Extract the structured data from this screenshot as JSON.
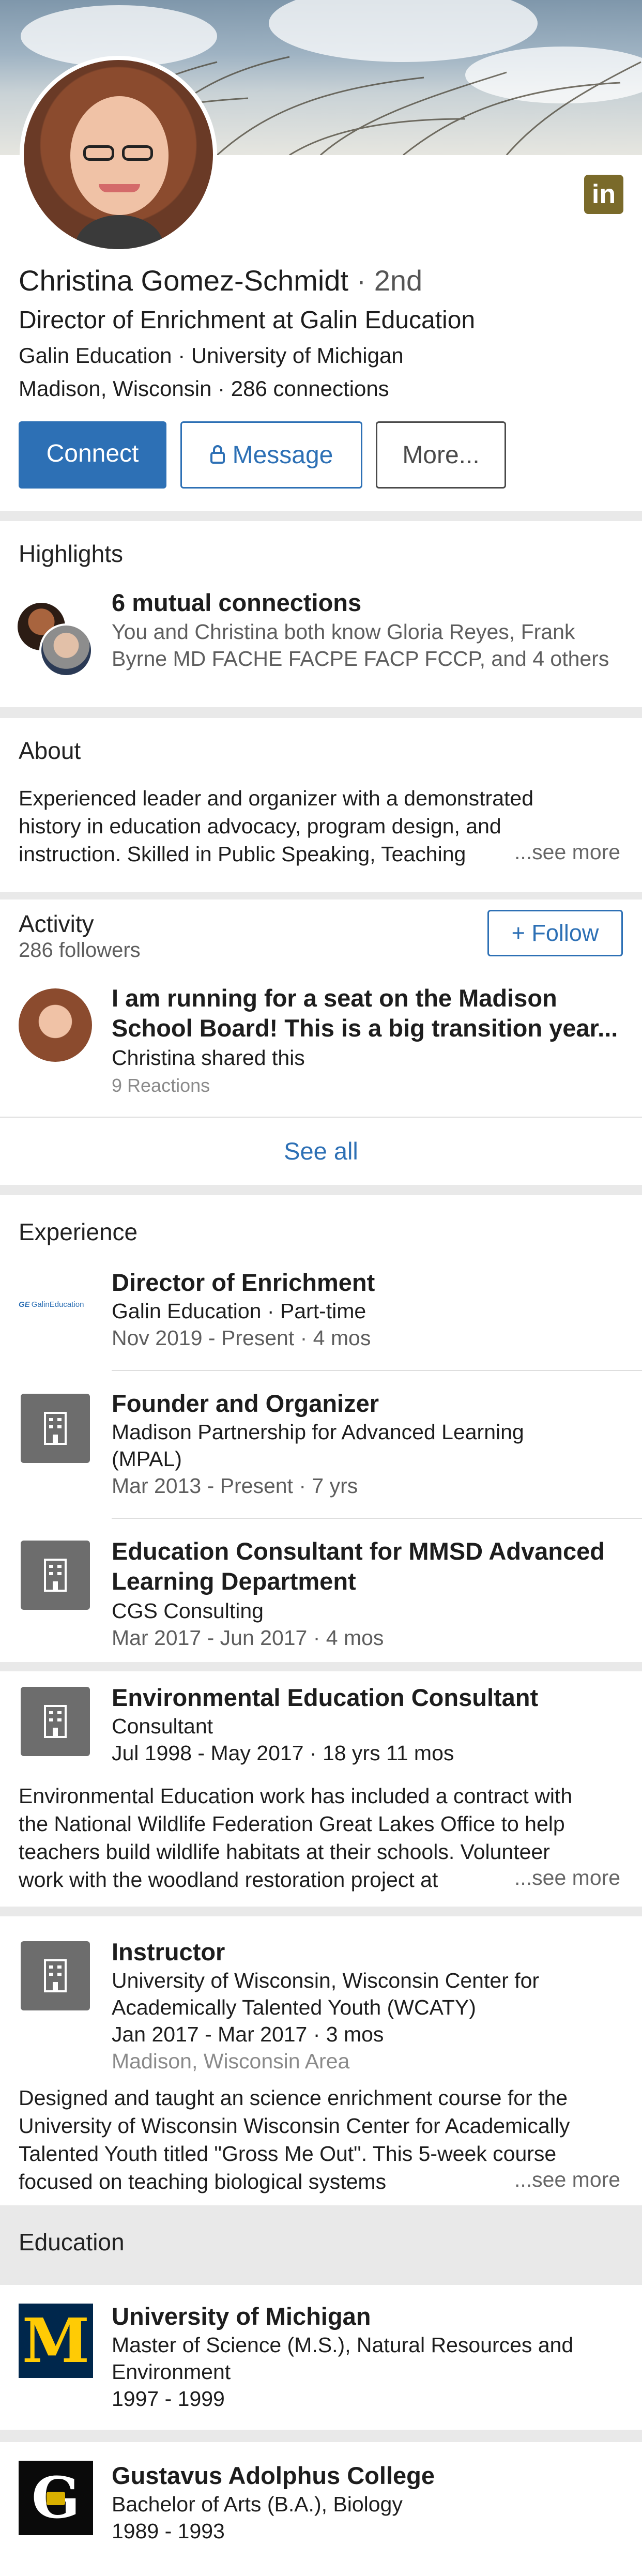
{
  "profile": {
    "name": "Christina Gomez-Schmidt",
    "degree": "· 2nd",
    "headline": "Director of Enrichment at Galin Education",
    "education_line": "Galin Education · University of Michigan",
    "location_line": "Madison, Wisconsin · 286 connections",
    "linkedin_logo": "in"
  },
  "actions": {
    "connect": "Connect",
    "message": "Message",
    "more": "More..."
  },
  "highlights": {
    "title": "Highlights",
    "mutual_title": "6 mutual connections",
    "mutual_text_1": "You and Christina both know Gloria Reyes, Frank",
    "mutual_text_2": "Byrne MD FACHE FACPE FACP FCCP, and 4 others"
  },
  "about": {
    "title": "About",
    "line1": "Experienced leader and organizer with a demonstrated",
    "line2": "history in education advocacy, program design, and",
    "line3": "instruction.  Skilled in Public Speaking, Teaching",
    "see_more": "...see more"
  },
  "activity": {
    "title": "Activity",
    "followers": "286 followers",
    "follow_button": "+ Follow",
    "post_title_1": "I am running for a seat on the Madison",
    "post_title_2": "School Board! This is a big transition year...",
    "post_shared": "Christina shared this",
    "post_reactions": "9 Reactions",
    "see_all": "See all"
  },
  "experience": {
    "title": "Experience",
    "items": [
      {
        "title": "Director of Enrichment",
        "company": "Galin Education · Part-time",
        "dates": "Nov 2019 - Present · 4 mos",
        "logo_text": "GalinEducation"
      },
      {
        "title": "Founder and Organizer",
        "company_1": "Madison Partnership for Advanced Learning",
        "company_2": "(MPAL)",
        "dates": "Mar 2013 - Present · 7 yrs"
      },
      {
        "title_1": "Education Consultant for MMSD Advanced",
        "title_2": "Learning Department",
        "company": "CGS Consulting",
        "dates": "Mar 2017 - Jun 2017 · 4 mos"
      },
      {
        "title": "Environmental Education Consultant",
        "company": "Consultant",
        "dates": "Jul 1998 - May 2017 · 18 yrs 11 mos",
        "desc_1": "Environmental Education work has included a contract with",
        "desc_2": "the National Wildlife Federation Great Lakes Office to help",
        "desc_3": "teachers build wildlife habitats at their schools. Volunteer",
        "desc_4": "work with the woodland restoration project at",
        "see_more": "...see more"
      },
      {
        "title": "Instructor",
        "company_1": "University of Wisconsin, Wisconsin Center for",
        "company_2": "Academically Talented Youth (WCATY)",
        "dates": "Jan 2017 - Mar 2017 · 3 mos",
        "location": "Madison, Wisconsin Area",
        "desc_1": "Designed and taught an science enrichment course for the",
        "desc_2": "University of Wisconsin Wisconsin Center for Academically",
        "desc_3": "Talented Youth titled \"Gross Me Out\".  This 5-week course",
        "desc_4": "focused on teaching biological systems",
        "see_more": "...see more"
      }
    ]
  },
  "education": {
    "title": "Education",
    "items": [
      {
        "school": "University of Michigan",
        "degree_1": "Master of Science (M.S.), Natural Resources and",
        "degree_2": "Environment",
        "years": "1997 - 1999",
        "logo_letter": "M"
      },
      {
        "school": "Gustavus Adolphus College",
        "degree": "Bachelor of Arts (B.A.), Biology",
        "years": "1989 - 1993",
        "logo_letter": "G"
      }
    ]
  },
  "colors": {
    "brand_blue": "#2d70b5",
    "michigan_blue": "#00274c",
    "michigan_maize": "#ffcb05",
    "linkedin_gold": "#7a6a2a"
  }
}
